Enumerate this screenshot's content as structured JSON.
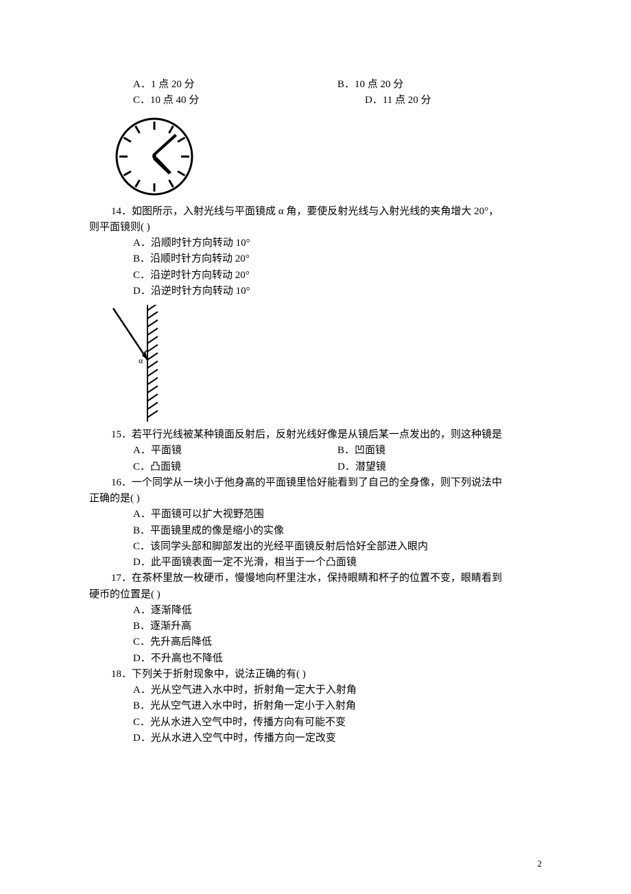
{
  "q13": {
    "A": "A．1 点 20 分",
    "B": "B．10 点 20 分",
    "C": "C．10 点 40 分",
    "D": "D．11 点 20 分"
  },
  "q14": {
    "stem_a": "14．如图所示，入射光线与平面镜成 α 角，要使反射光线与入射光线的夹角增大 20°，",
    "stem_b": "则平面镜则(            )",
    "A": "A．沿顺时针方向转动 10°",
    "B": "B．沿顺时针方向转动 20°",
    "C": "C．沿逆时针方向转动 20°",
    "D": "D．沿逆时针方向转动 10°"
  },
  "q15": {
    "stem": "15．若平行光线被某种镜面反射后，反射光线好像是从镜后某一点发出的，则这种镜是",
    "A": "A．平面镜",
    "B": "B．凹面镜",
    "C": "C．凸面镜",
    "D": "D．潜望镜"
  },
  "q16": {
    "stem_a": "16．一个同学从一块小于他身高的平面镜里恰好能看到了自己的全身像，则下列说法中",
    "stem_b": "正确的是(            )",
    "A": "A．平面镜可以扩大视野范围",
    "B": "B．平面镜里成的像是缩小的实像",
    "C": "C．该同学头部和脚部发出的光经平面镜反射后恰好全部进入眼内",
    "D": "D．此平面镜表面一定不光滑，相当于一个凸面镜"
  },
  "q17": {
    "stem_a": "17．在茶杯里放一枚硬币，慢慢地向杯里注水，保持眼睛和杯子的位置不变，眼睛看到",
    "stem_b": "硬币的位置是(            )",
    "A": "A．逐渐降低",
    "B": "B．逐渐升高",
    "C": "C．先升高后降低",
    "D": "D．不升高也不降低"
  },
  "q18": {
    "stem": "18．下列关于折射现象中，说法正确的有(            )",
    "A": "A．光从空气进入水中时，折射角一定大于入射角",
    "B": "B．光从空气进入水中时，折射角一定小于入射角",
    "C": "C．光从水进入空气中时，传播方向有可能不变",
    "D": "D．光从水进入空气中时，传播方向一定改变"
  },
  "page_number": "2"
}
